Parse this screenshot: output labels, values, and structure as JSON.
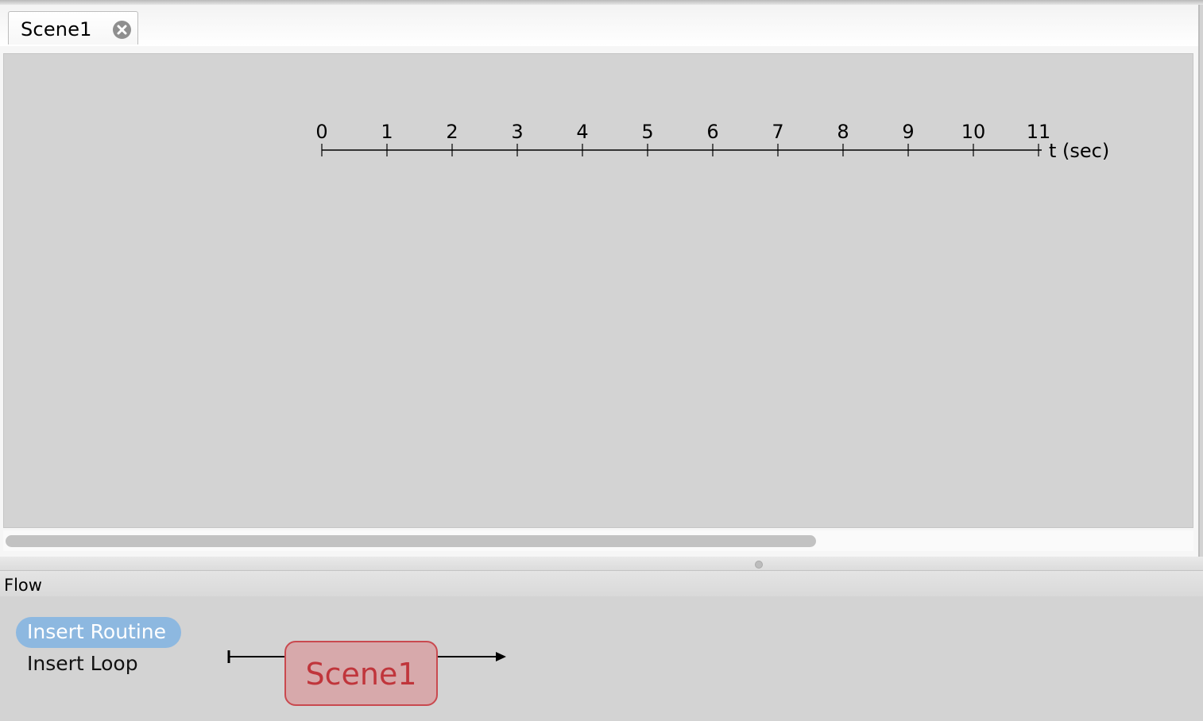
{
  "tabs": [
    {
      "label": "Scene1",
      "close_icon": "close-circle-icon"
    }
  ],
  "timeline": {
    "ticks": [
      "0",
      "1",
      "2",
      "3",
      "4",
      "5",
      "6",
      "7",
      "8",
      "9",
      "10",
      "11"
    ],
    "unit_label": "t (sec)"
  },
  "flow": {
    "title": "Flow",
    "insert_routine_label": "Insert Routine",
    "insert_loop_label": "Insert Loop",
    "routines": [
      {
        "label": "Scene1"
      }
    ]
  },
  "colors": {
    "insert_routine_bg": "#8db8e0",
    "routine_fill": "#d7a9ab",
    "routine_border": "#c9494f",
    "routine_text": "#c0353b"
  }
}
